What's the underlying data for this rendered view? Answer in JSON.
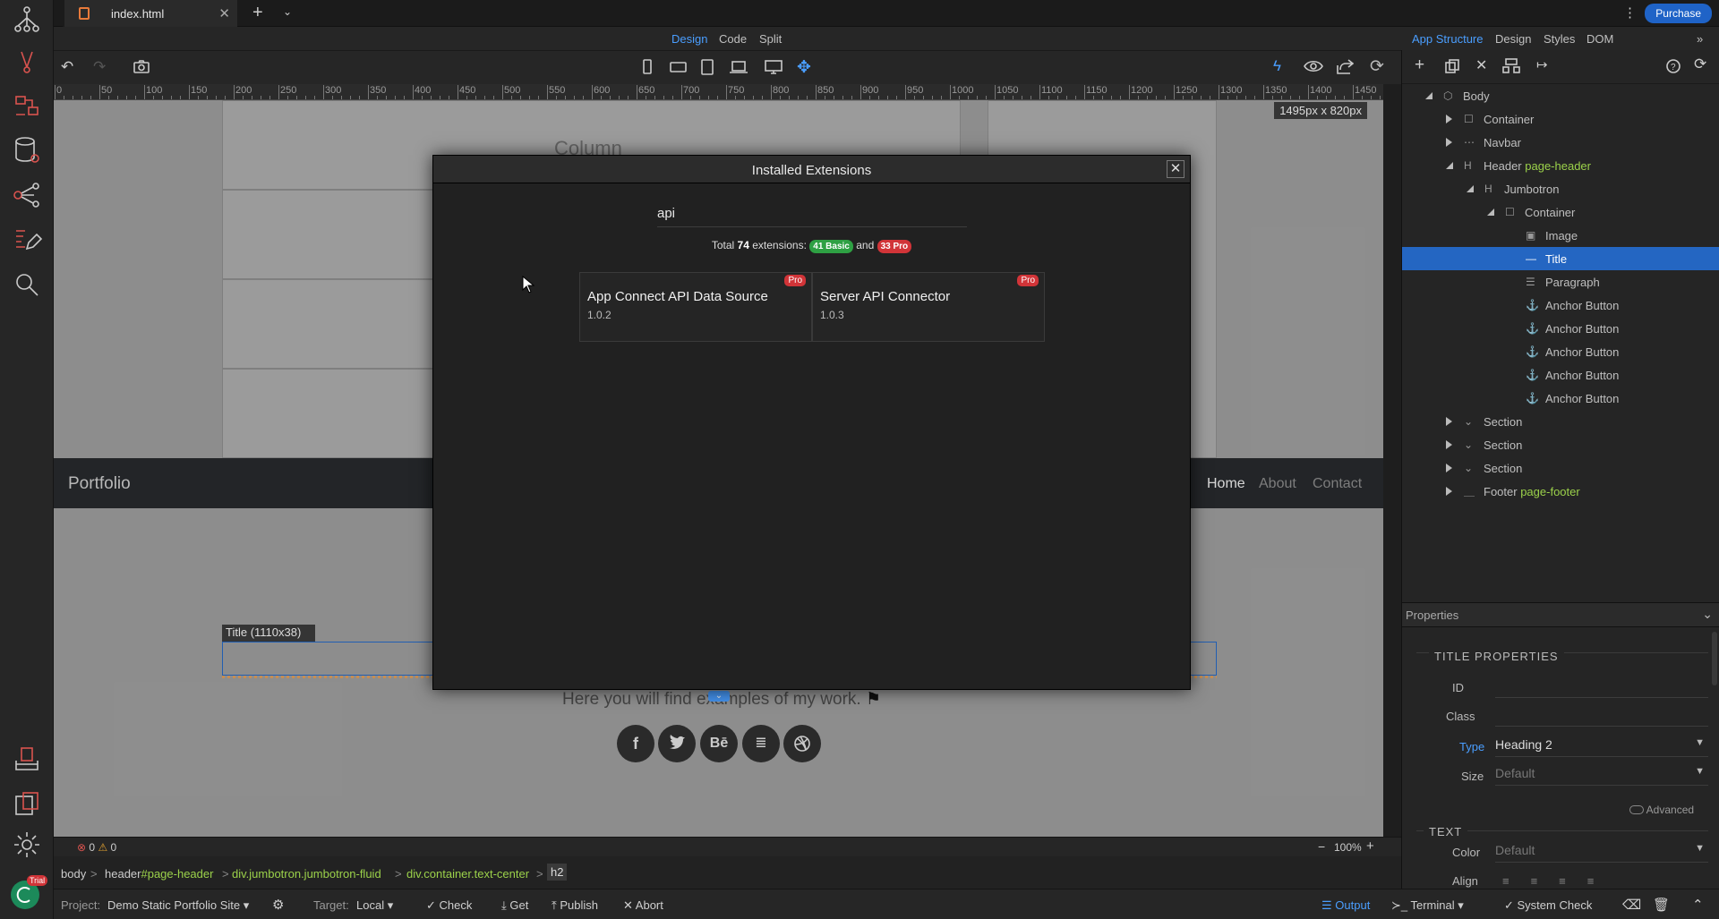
{
  "app": {
    "tab_title": "index.html",
    "purchase_label": "Purchase"
  },
  "modes": {
    "left": [
      "Design",
      "Code",
      "Split"
    ],
    "right": [
      "App Structure",
      "Design",
      "Styles",
      "DOM"
    ]
  },
  "colors": {
    "accent": "#4a9eff",
    "selection": "#2466c2",
    "basic_badge": "#2ea043",
    "pro_badge": "#d13438",
    "green_text": "#9bd14a"
  },
  "ruler": {
    "labels": [
      "0",
      "50",
      "100",
      "150",
      "200",
      "250",
      "300",
      "350",
      "400",
      "450",
      "500",
      "550",
      "600",
      "650",
      "700",
      "750",
      "800",
      "850",
      "900",
      "950",
      "1000",
      "1050",
      "1100",
      "1150",
      "1200",
      "1250",
      "1300",
      "1350",
      "1400",
      "1450"
    ]
  },
  "canvas": {
    "dimensions": "1495px x 820px",
    "column_text": "Column",
    "brand": "Portfolio",
    "nav_links": [
      "Home",
      "About",
      "Contact"
    ],
    "selection_label": "Title (1110x38)",
    "paragraph_text": "Here you will find examples of my work.",
    "social_icons": [
      "facebook-icon",
      "twitter-icon",
      "behance-icon",
      "stackoverflow-icon",
      "dribbble-icon"
    ]
  },
  "modal": {
    "title": "Installed Extensions",
    "search_value": "api",
    "totals": {
      "prefix": "Total",
      "count": "74",
      "middle": "extensions:",
      "basic": "41 Basic",
      "and": "and",
      "pro": "33 Pro"
    },
    "extensions": [
      {
        "name": "App Connect API Data Source",
        "version": "1.0.2",
        "badge": "Pro"
      },
      {
        "name": "Server API Connector",
        "version": "1.0.3",
        "badge": "Pro"
      }
    ]
  },
  "tree": [
    {
      "label": "Body",
      "extra": "",
      "icon": "cube-icon"
    },
    {
      "label": "Container",
      "extra": "",
      "icon": "square-icon"
    },
    {
      "label": "Navbar",
      "extra": "",
      "icon": "dots-icon"
    },
    {
      "label": "Header",
      "extra": "page-header",
      "icon": "heading-icon"
    },
    {
      "label": "Jumbotron",
      "extra": "",
      "icon": "heading-icon"
    },
    {
      "label": "Container",
      "extra": "",
      "icon": "square-icon"
    },
    {
      "label": "Image",
      "extra": "",
      "icon": "image-icon"
    },
    {
      "label": "Title",
      "extra": "",
      "icon": "dash-icon"
    },
    {
      "label": "Paragraph",
      "extra": "",
      "icon": "lines-icon"
    },
    {
      "label": "Anchor Button",
      "extra": "",
      "icon": "anchor-icon"
    },
    {
      "label": "Anchor Button",
      "extra": "",
      "icon": "anchor-icon"
    },
    {
      "label": "Anchor Button",
      "extra": "",
      "icon": "anchor-icon"
    },
    {
      "label": "Anchor Button",
      "extra": "",
      "icon": "anchor-icon"
    },
    {
      "label": "Anchor Button",
      "extra": "",
      "icon": "anchor-icon"
    },
    {
      "label": "Section",
      "extra": "",
      "icon": "chevrons-icon"
    },
    {
      "label": "Section",
      "extra": "",
      "icon": "chevrons-icon"
    },
    {
      "label": "Section",
      "extra": "",
      "icon": "chevrons-icon"
    },
    {
      "label": "Footer",
      "extra": "page-footer",
      "icon": "underscore-icon"
    }
  ],
  "properties": {
    "header": "Properties",
    "section_title": "TITLE PROPERTIES",
    "id_label": "ID",
    "class_label": "Class",
    "type_label": "Type",
    "type_value": "Heading 2",
    "size_label": "Size",
    "size_value": "Default",
    "advanced_label": "Advanced",
    "text_section": "TEXT",
    "color_label": "Color",
    "color_value": "Default",
    "align_label": "Align"
  },
  "status": {
    "errors": "0",
    "warnings": "0",
    "zoom": "100%"
  },
  "breadcrumb": [
    {
      "text": "body",
      "extra": ""
    },
    {
      "text": "header",
      "extra": "#page-header"
    },
    {
      "text": "div.jumbotron.jumbotron-fluid",
      "extra": ""
    },
    {
      "text": "div.container.text-center",
      "extra": ""
    },
    {
      "text": "h2",
      "extra": ""
    }
  ],
  "bottom": {
    "trial": "Trial",
    "project_label": "Project:",
    "project_value": "Demo Static Portfolio Site",
    "target_label": "Target:",
    "target_value": "Local",
    "check": "Check",
    "get": "Get",
    "publish": "Publish",
    "abort": "Abort",
    "output": "Output",
    "terminal": "Terminal",
    "system_check": "System Check"
  }
}
